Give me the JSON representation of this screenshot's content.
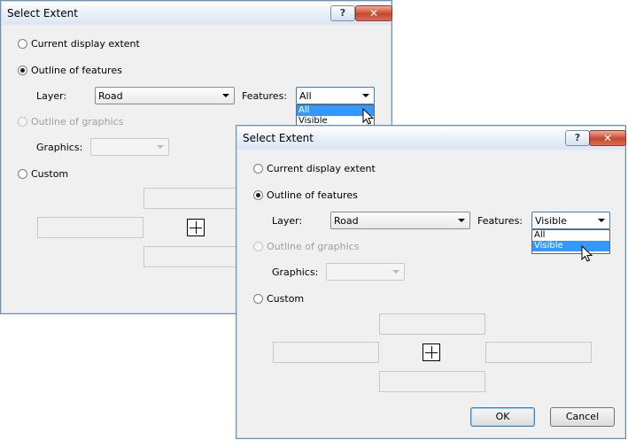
{
  "dialogs": [
    {
      "title": "Select Extent",
      "help_label": "?",
      "close_label": "✕",
      "radio_current": "Current display extent",
      "radio_outline_features": "Outline of features",
      "layer_label": "Layer:",
      "layer_value": "Road",
      "features_label": "Features:",
      "features_value": "All",
      "features_options": [
        "All",
        "Visible"
      ],
      "features_highlighted": "All",
      "radio_outline_graphics": "Outline of graphics",
      "graphics_label": "Graphics:",
      "radio_custom": "Custom"
    },
    {
      "title": "Select Extent",
      "help_label": "?",
      "close_label": "✕",
      "radio_current": "Current display extent",
      "radio_outline_features": "Outline of features",
      "layer_label": "Layer:",
      "layer_value": "Road",
      "features_label": "Features:",
      "features_value": "Visible",
      "features_options": [
        "All",
        "Visible"
      ],
      "features_highlighted": "Visible",
      "radio_outline_graphics": "Outline of graphics",
      "graphics_label": "Graphics:",
      "radio_custom": "Custom",
      "ok_label": "OK",
      "cancel_label": "Cancel"
    }
  ],
  "icons": {
    "help": "help-icon",
    "close": "close-icon",
    "dropdown": "chevron-down-icon",
    "pan": "pan-extent-icon",
    "cursor": "mouse-pointer-icon"
  }
}
